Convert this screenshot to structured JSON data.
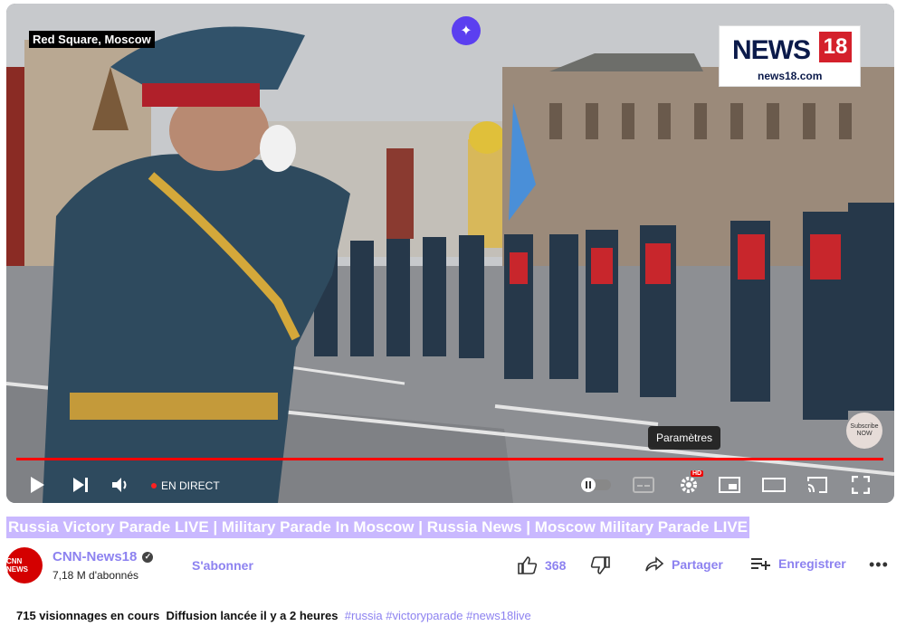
{
  "video": {
    "location_label": "Red Square, Moscow",
    "logo": {
      "brand": "NEWS",
      "number": "18",
      "url": "news18.com"
    },
    "watermark": "Subscribe NOW",
    "tooltip": "Paramètres",
    "progress": 1.0,
    "controls": {
      "live_label": "EN DIRECT",
      "hd_badge": "HD"
    },
    "accent": "#ff0000"
  },
  "title": "Russia Victory Parade LIVE | Military Parade In Moscow | Russia News | Moscow Military Parade LIVE",
  "channel": {
    "avatar_text": "CNN NEWS",
    "name": "CNN-News18",
    "subscribers": "7,18 M d'abonnés",
    "subscribe_label": "S'abonner"
  },
  "actions": {
    "likes": "368",
    "share_label": "Partager",
    "save_label": "Enregistrer",
    "more": "•••"
  },
  "meta": {
    "viewers": "715 visionnages en cours",
    "started": "Diffusion lancée il y a 2 heures",
    "tags": [
      "#russia",
      "#victoryparade",
      "#news18live"
    ]
  }
}
